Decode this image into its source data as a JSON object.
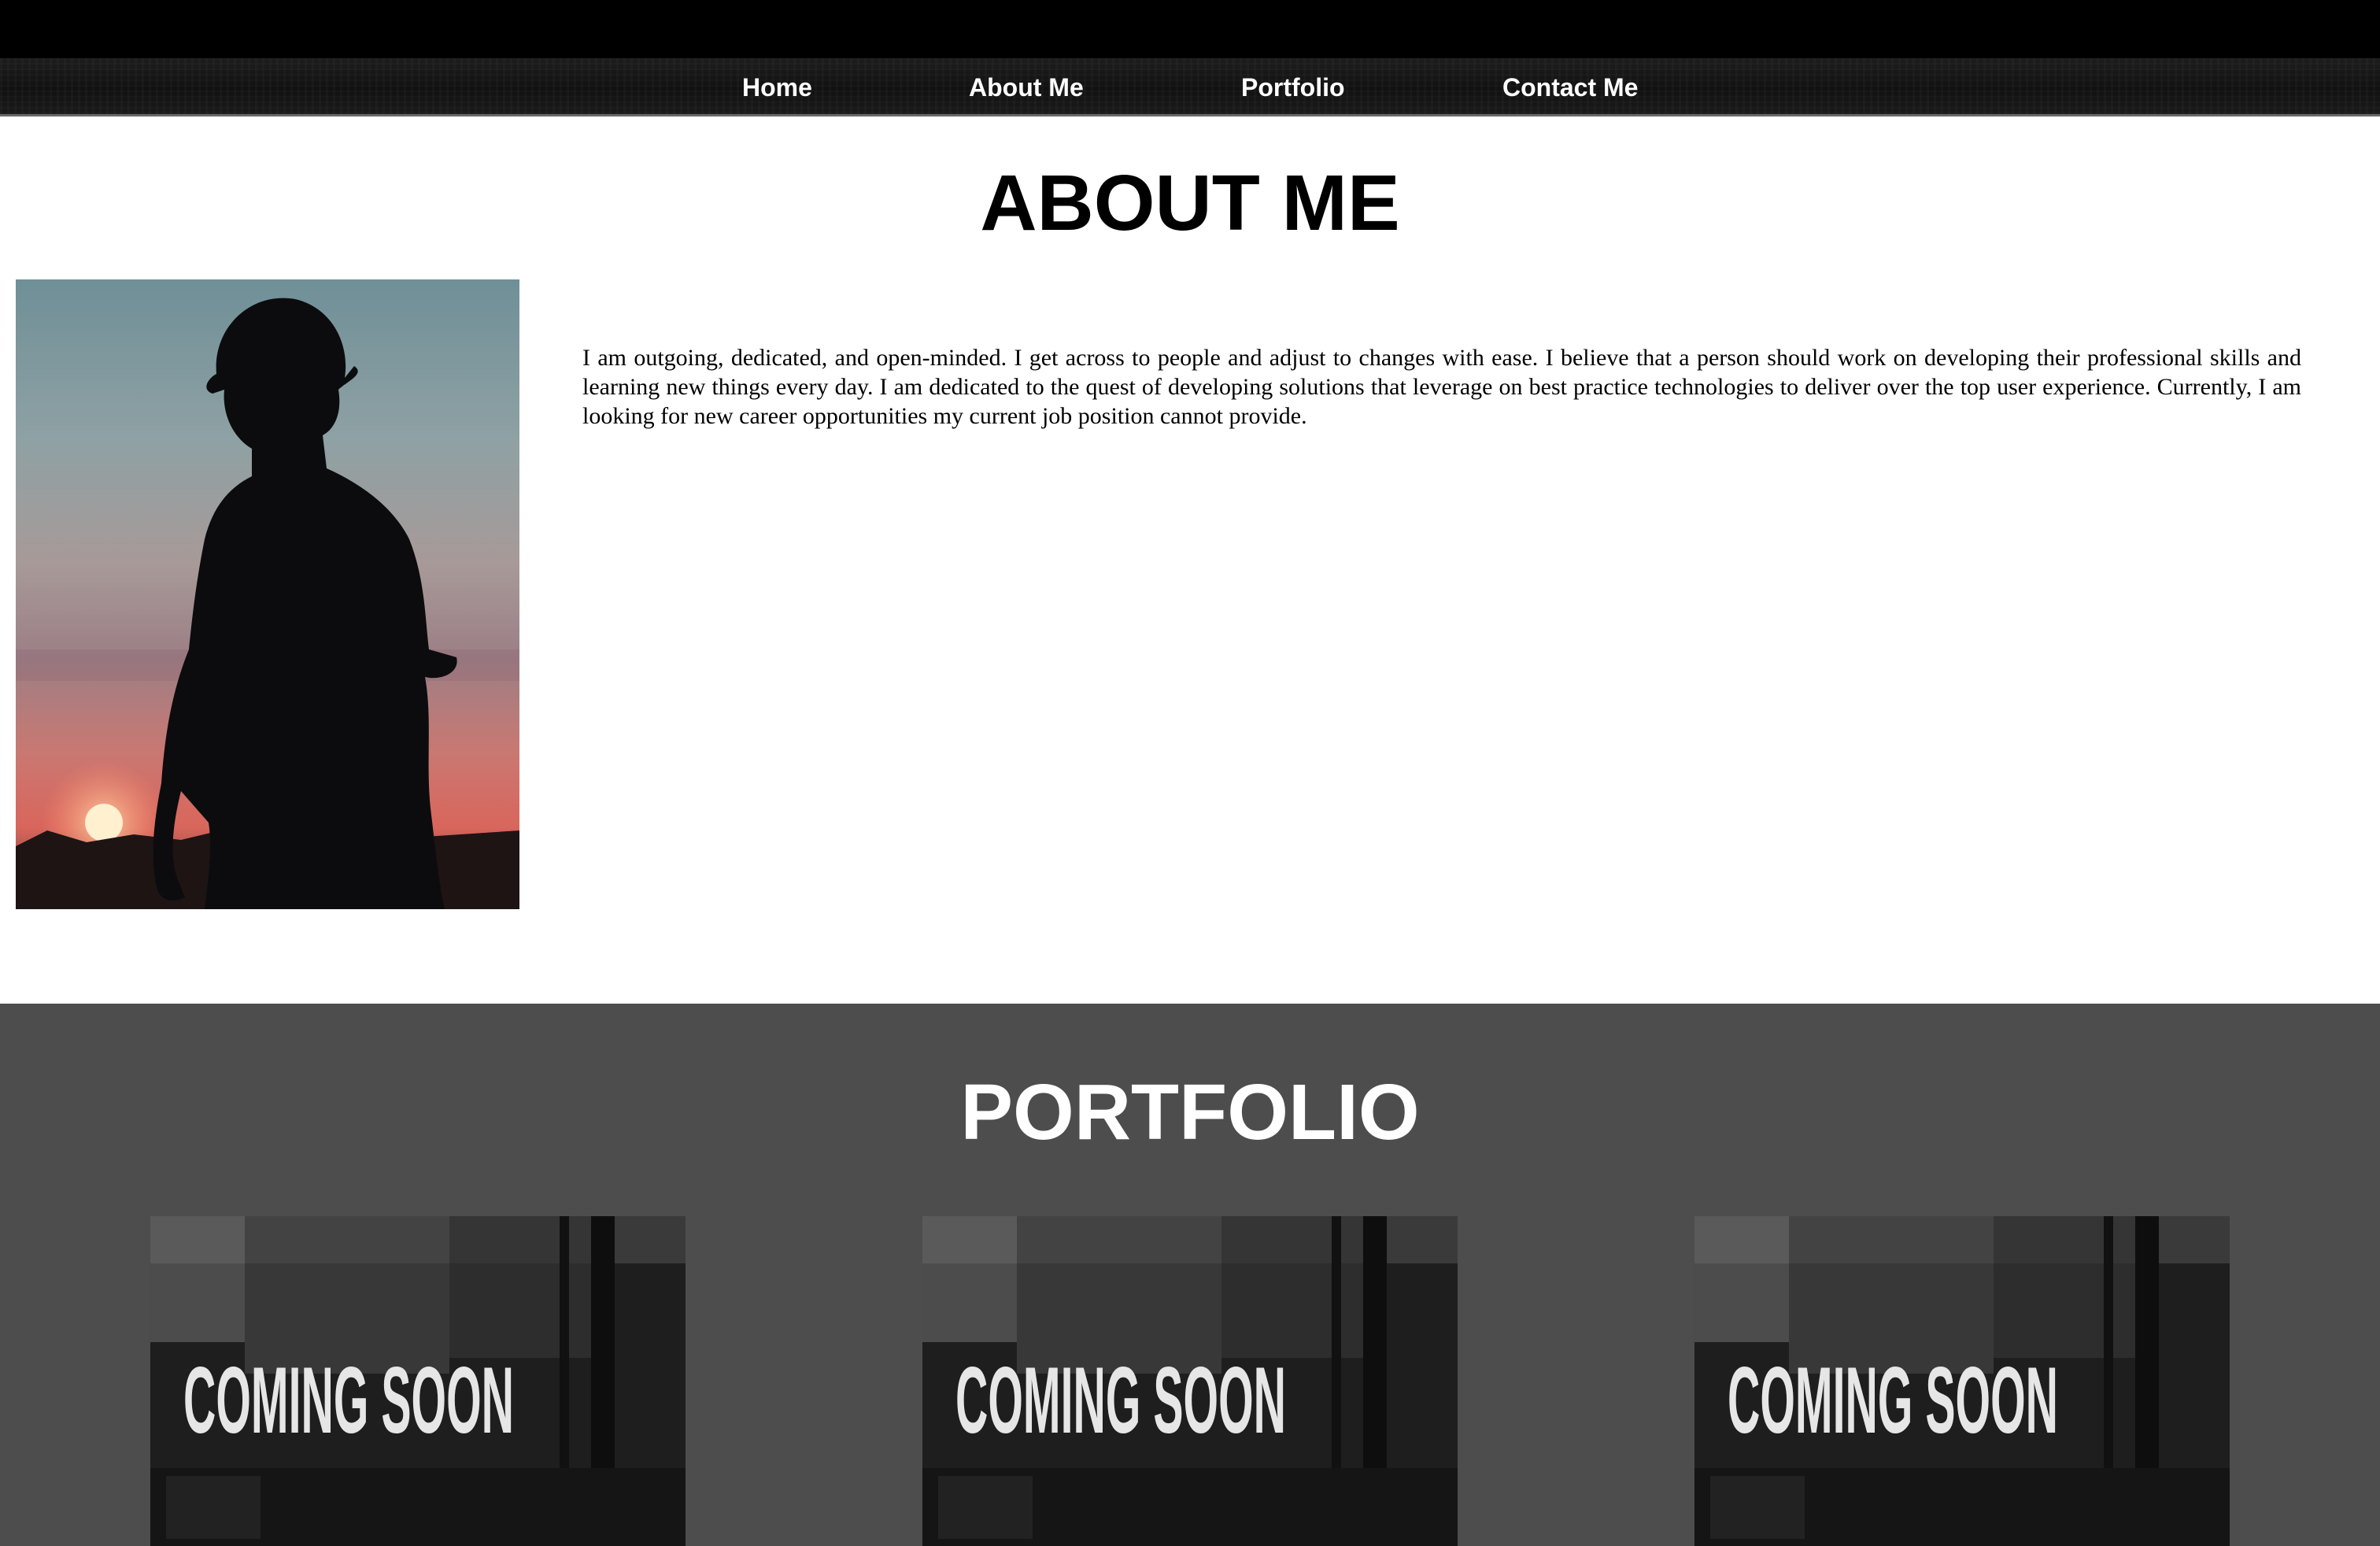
{
  "nav": {
    "items": [
      {
        "label": "Home"
      },
      {
        "label": "About Me"
      },
      {
        "label": "Portfolio"
      },
      {
        "label": "Contact Me"
      }
    ]
  },
  "about": {
    "heading": "ABOUT ME",
    "photo_icon": "silhouette-sunset-photo",
    "bio": "I am outgoing, dedicated, and open-minded. I get across to people and adjust to changes with ease. I believe that a person should work on developing their professional skills and learning new things every day. I am dedicated to the quest of developing solutions that leverage on best practice technologies to deliver over the top user experience. Currently, I am looking for new career opportunities my current job position cannot provide."
  },
  "portfolio": {
    "heading": "PORTFOLIO",
    "cards": [
      {
        "caption": "COMING SOON"
      },
      {
        "caption": "COMING SOON"
      },
      {
        "caption": "COMING SOON"
      }
    ]
  },
  "colors": {
    "top_strip": "#000000",
    "navbar": "#151515",
    "nav_text": "#ffffff",
    "page_bg": "#ffffff",
    "portfolio_bg": "#4d4d4d",
    "heading_light": "#ffffff",
    "heading_dark": "#000000"
  }
}
